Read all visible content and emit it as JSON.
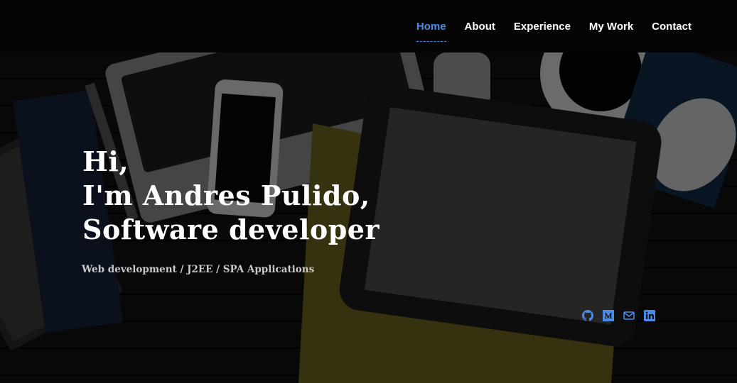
{
  "nav": {
    "items": [
      {
        "label": "Home",
        "active": true
      },
      {
        "label": "About",
        "active": false
      },
      {
        "label": "Experience",
        "active": false
      },
      {
        "label": "My Work",
        "active": false
      },
      {
        "label": "Contact",
        "active": false
      }
    ]
  },
  "hero": {
    "title_lines": [
      "Hi,",
      "I'm Andres Pulido,",
      "Software developer"
    ],
    "subtitle": "Web development / J2EE / SPA Applications"
  },
  "social": [
    {
      "icon": "github-icon"
    },
    {
      "icon": "medium-icon"
    },
    {
      "icon": "email-icon"
    },
    {
      "icon": "linkedin-icon"
    }
  ],
  "colors": {
    "accent": "#4a8be8",
    "nav_background": "#050505",
    "title_text": "#ffffff",
    "subtitle_text": "#c9c9c9"
  }
}
